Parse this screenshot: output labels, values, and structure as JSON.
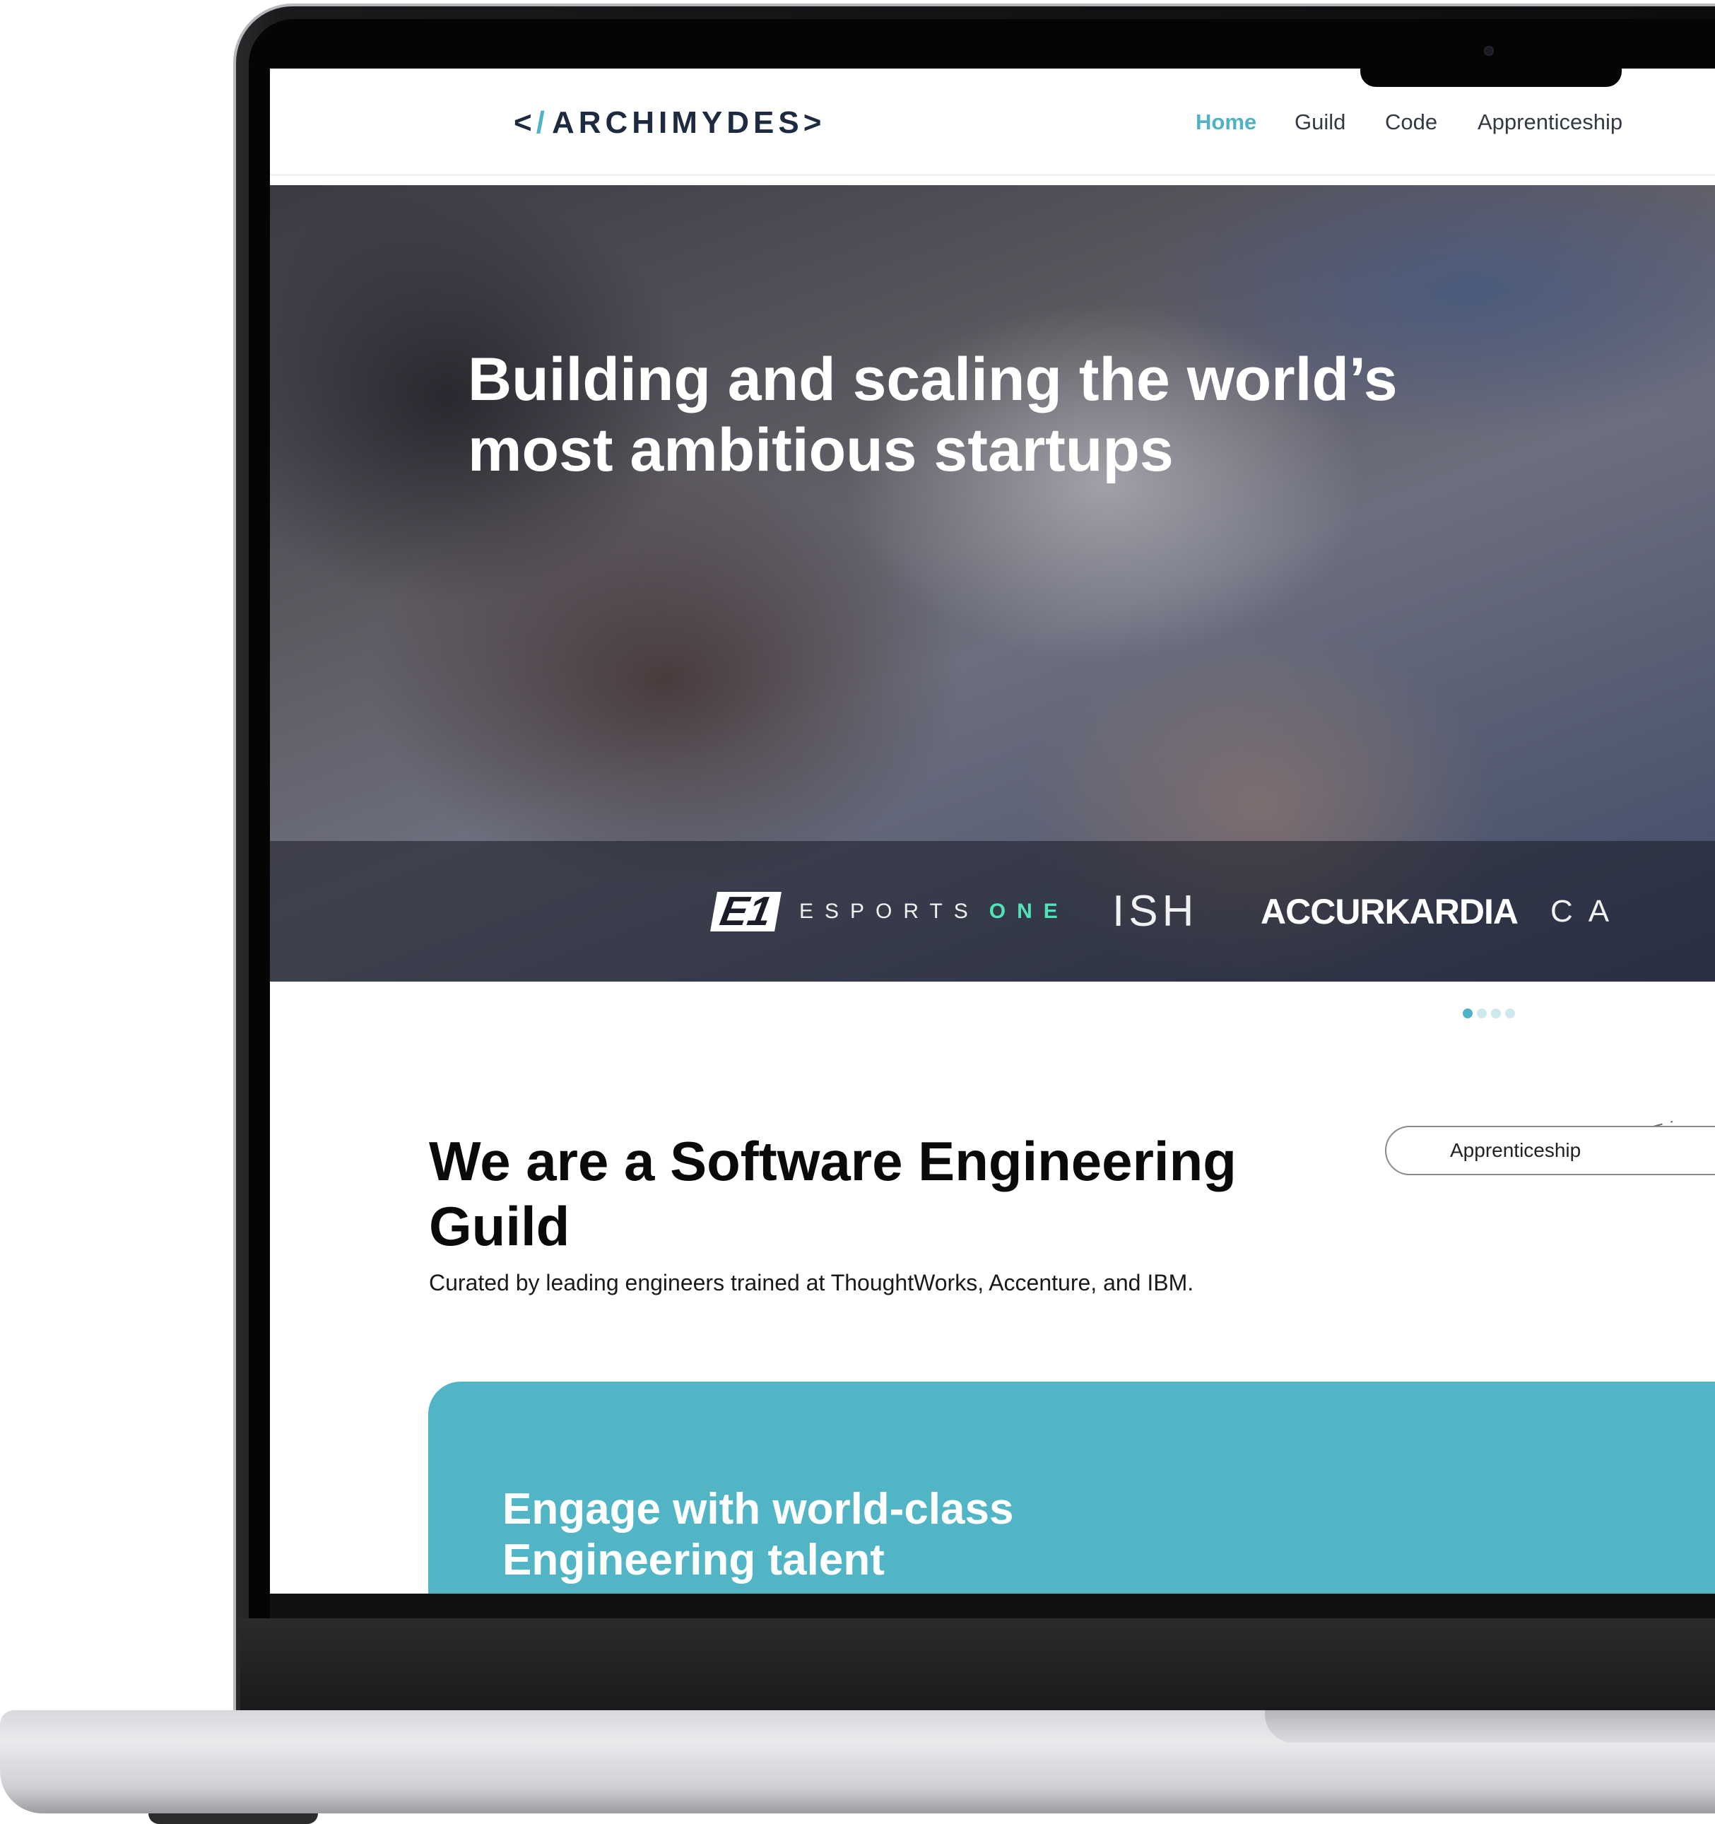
{
  "nav": {
    "logo_text": "ARCHIMYDES",
    "links": [
      "Home",
      "Guild",
      "Code",
      "Apprenticeship"
    ],
    "active": "Home"
  },
  "hero": {
    "title": "Building and scaling the world’s most ambitious startups"
  },
  "clients": {
    "esports_mark": "E1",
    "esports_word": "ESPORTS",
    "esports_suffix": "ONE",
    "ish": "ISH",
    "accurkardia": "ACCURKARDIA",
    "partial": "CA"
  },
  "carousel": {
    "count": 4,
    "active_index": 0
  },
  "guild": {
    "title": "We are a Software Engineering Guild",
    "subtitle": "Curated by leading engineers trained at ThoughtWorks, Accenture, and IBM.",
    "apprenticeship_button": "Apprenticeship"
  },
  "engage": {
    "title": "Engage with world-class Engineering talent"
  },
  "colors": {
    "accent": "#4fb3c4",
    "card": "#51b5c5",
    "heading": "#0a0a0a",
    "logo": "#1d2a40"
  }
}
